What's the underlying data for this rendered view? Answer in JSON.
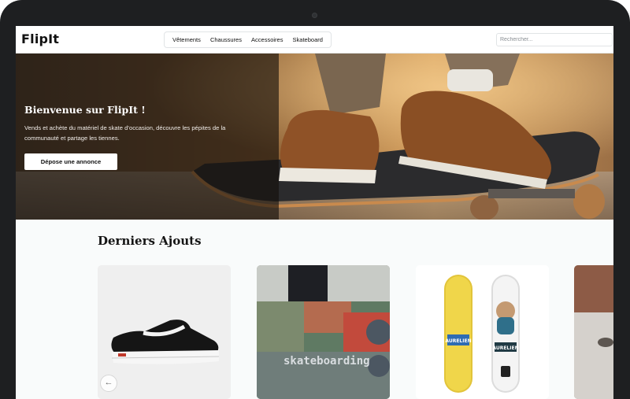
{
  "header": {
    "logo": "FlipIt",
    "nav": [
      "Vêtements",
      "Chaussures",
      "Accessoires",
      "Skateboard"
    ],
    "search_placeholder": "Rechercher..."
  },
  "hero": {
    "title": "Bienvenue sur FlipIt !",
    "description": "Vends et achète du matériel de skate d’occasion, découvre les pépites de la communauté et partage les tiennes.",
    "cta": "Dépose une annonce"
  },
  "latest": {
    "title": "Derniers Ajouts",
    "items": [
      {
        "image": "black-white-sneaker"
      },
      {
        "image": "skateboarding-deck-graffiti",
        "deck_text": "skateboarding"
      },
      {
        "image": "two-skate-decks",
        "deck_text_left": "AURELIEN",
        "deck_text_right": "AURELIEN"
      },
      {
        "image": "skatepark-photo"
      }
    ],
    "prev_icon": "arrow-left-icon"
  },
  "colors": {
    "frame": "#1e1f21",
    "page_bg": "#f9fbfb",
    "hero_overlay": "#140e0a"
  }
}
